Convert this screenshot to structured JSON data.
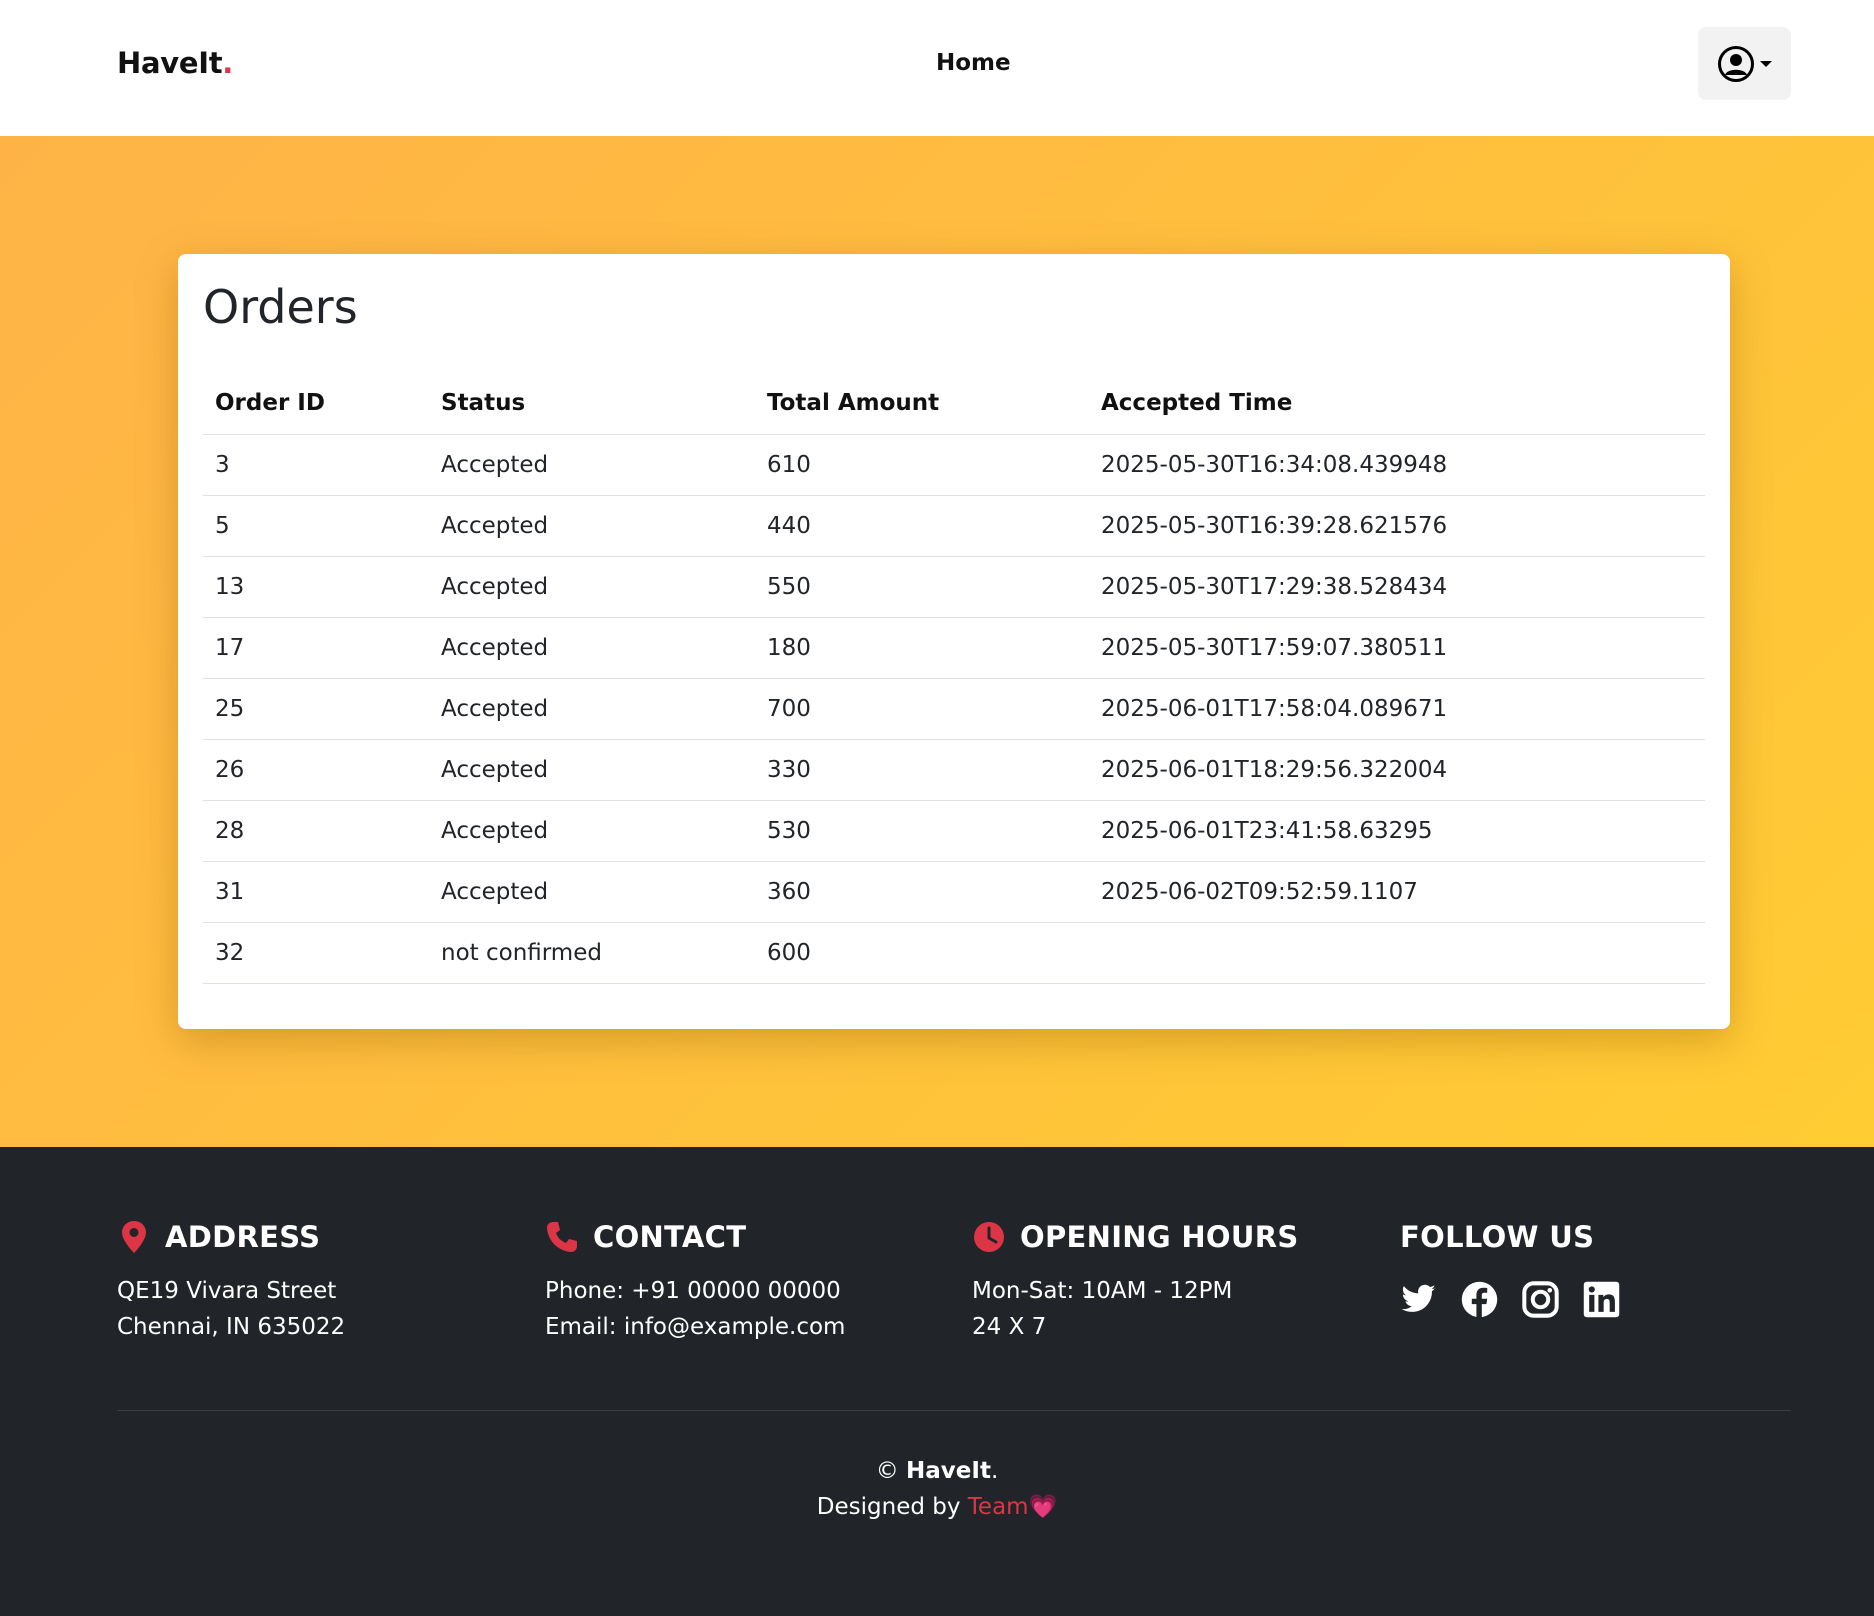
{
  "navbar": {
    "brand": "HaveIt",
    "brand_dot": ".",
    "home": "Home"
  },
  "orders": {
    "title": "Orders",
    "columns": [
      "Order ID",
      "Status",
      "Total Amount",
      "Accepted Time"
    ],
    "rows": [
      [
        "3",
        "Accepted",
        "610",
        "2025-05-30T16:34:08.439948"
      ],
      [
        "5",
        "Accepted",
        "440",
        "2025-05-30T16:39:28.621576"
      ],
      [
        "13",
        "Accepted",
        "550",
        "2025-05-30T17:29:38.528434"
      ],
      [
        "17",
        "Accepted",
        "180",
        "2025-05-30T17:59:07.380511"
      ],
      [
        "25",
        "Accepted",
        "700",
        "2025-06-01T17:58:04.089671"
      ],
      [
        "26",
        "Accepted",
        "330",
        "2025-06-01T18:29:56.322004"
      ],
      [
        "28",
        "Accepted",
        "530",
        "2025-06-01T23:41:58.63295"
      ],
      [
        "31",
        "Accepted",
        "360",
        "2025-06-02T09:52:59.1107"
      ],
      [
        "32",
        "not confirmed",
        "600",
        ""
      ]
    ]
  },
  "footer": {
    "address": {
      "heading": "ADDRESS",
      "line1": "QE19 Vivara Street",
      "line2": "Chennai, IN 635022"
    },
    "contact": {
      "heading": "CONTACT",
      "line1": "Phone: +91 00000 00000",
      "line2": "Email: info@example.com"
    },
    "hours": {
      "heading": "OPENING HOURS",
      "line1": "Mon-Sat: 10AM - 12PM",
      "line2": "24 X 7"
    },
    "follow": {
      "heading": "FOLLOW US",
      "icons": [
        "twitter-icon",
        "facebook-icon",
        "instagram-icon",
        "linkedin-icon"
      ]
    },
    "copyright_symbol": "©",
    "copyright_brand": "HaveIt",
    "copyright_dot": ".",
    "designed_by": "Designed by",
    "team": "Team",
    "heart": "💗"
  },
  "colors": {
    "accent": "#dc3545",
    "hero_start": "#ffb347",
    "hero_end": "#ffcc33",
    "footer_bg": "#212529"
  }
}
